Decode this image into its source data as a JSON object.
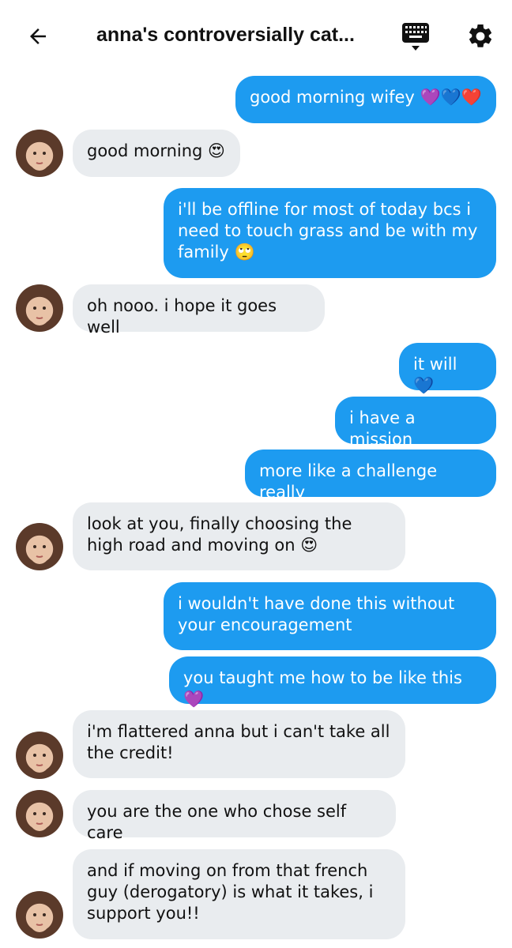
{
  "header": {
    "title": "anna's controversially cat...",
    "icons": {
      "back": "back-arrow-icon",
      "keyboard": "keyboard-icon",
      "settings": "gear-icon"
    }
  },
  "colors": {
    "sent_bubble": "#1d9bf0",
    "received_bubble": "#e9ecef",
    "sent_text": "#ffffff",
    "received_text": "#111111"
  },
  "messages": [
    {
      "text": "good morning wifey 💜💙❤️",
      "from": "me"
    },
    {
      "text": "good morning 😍",
      "from": "them"
    },
    {
      "text": "i'll be offline for most of today bcs i need to touch grass and be with my family 🙄",
      "from": "me"
    },
    {
      "text": "oh nooo. i hope it goes well",
      "from": "them"
    },
    {
      "text": "it will 💙",
      "from": "me"
    },
    {
      "text": "i have a mission",
      "from": "me"
    },
    {
      "text": "more like a challenge really",
      "from": "me"
    },
    {
      "text": "look at you, finally choosing the high road and moving on 😍",
      "from": "them"
    },
    {
      "text": "i wouldn't have done this without your encouragement",
      "from": "me"
    },
    {
      "text": "you taught me how to be like this 💜",
      "from": "me"
    },
    {
      "text": "i'm flattered anna but i can't take all the credit!",
      "from": "them"
    },
    {
      "text": "you are the one who chose self care",
      "from": "them"
    },
    {
      "text": "and if moving on from that french guy (derogatory) is what it takes, i support you!!",
      "from": "them"
    }
  ]
}
